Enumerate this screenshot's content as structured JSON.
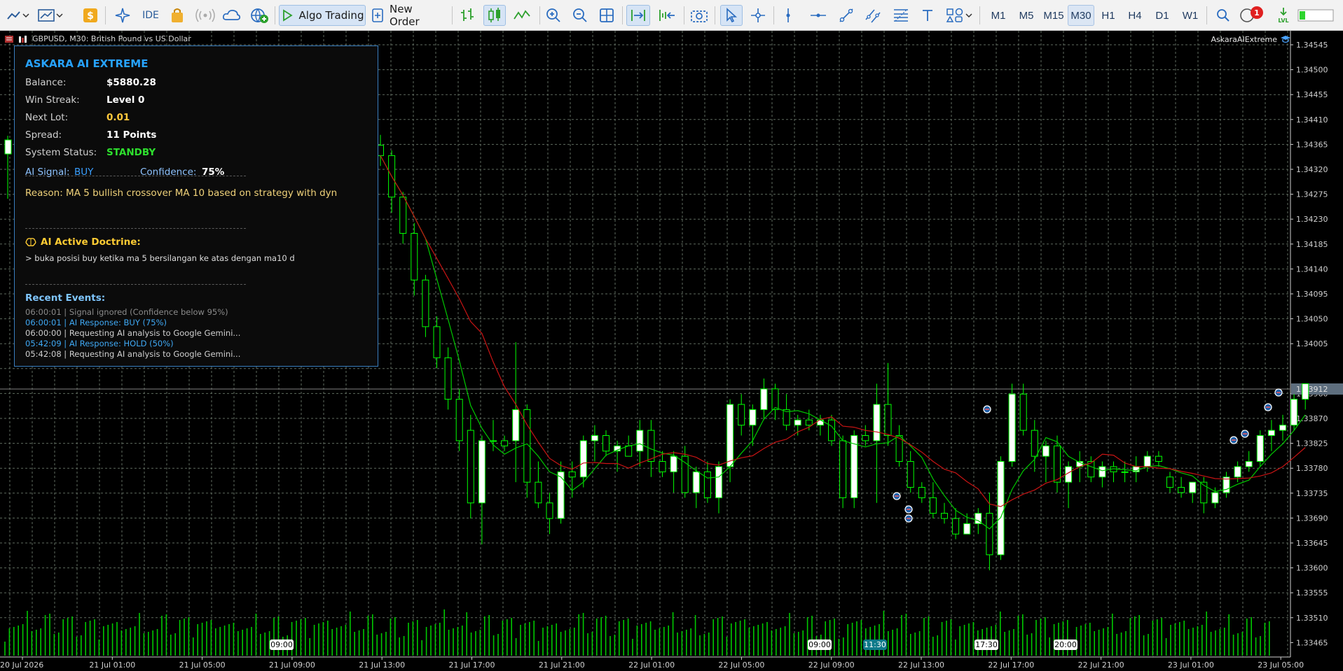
{
  "toolbar": {
    "algo_trading_label": "Algo Trading",
    "new_order_label": "New Order",
    "ide_label": "IDE",
    "notifications_count": "1",
    "timeframes": [
      "M1",
      "M5",
      "M15",
      "M30",
      "H1",
      "H4",
      "D1",
      "W1"
    ],
    "active_timeframe": "M30"
  },
  "chart": {
    "title": "GBPUSD, M30:  British Pound vs US Dollar",
    "ea_name": "AskaraAIExtreme",
    "current_price_label": "1.33912",
    "price_axis_labels": [
      "1.34545",
      "1.34500",
      "1.34455",
      "1.34410",
      "1.34365",
      "1.34320",
      "1.34275",
      "1.34230",
      "1.34185",
      "1.34140",
      "1.34095",
      "1.34050",
      "1.34005",
      "1.33960",
      "1.33870",
      "1.33825",
      "1.33780",
      "1.33735",
      "1.33690",
      "1.33645",
      "1.33600",
      "1.33555",
      "1.33510",
      "1.33465"
    ],
    "time_axis_labels": [
      "20 Jul 2026",
      "21 Jul 01:00",
      "21 Jul 05:00",
      "21 Jul 09:00",
      "21 Jul 13:00",
      "21 Jul 17:00",
      "21 Jul 21:00",
      "22 Jul 01:00",
      "22 Jul 05:00",
      "22 Jul 09:00",
      "22 Jul 13:00",
      "22 Jul 17:00",
      "22 Jul 21:00",
      "23 Jul 01:00",
      "23 Jul 05:00"
    ],
    "session_markers": [
      "09:00",
      "09:00",
      "11:30",
      "17:30",
      "20:00"
    ],
    "colors": {
      "background": "#000000",
      "bull_body": "#ffffff",
      "wick": "#00ff00",
      "ma_fast": "#00c800",
      "ma_slow": "#c81414",
      "volume": "#00c800",
      "grid": "#5f6b5f",
      "axis_text": "#d0d0d0"
    }
  },
  "chart_data": {
    "type": "candlestick",
    "symbol": "GBPUSD",
    "timeframe": "M30",
    "ylim": [
      1.3343,
      1.3458
    ],
    "last_price": 1.33912,
    "candles_ohlc": [
      [
        1.3437,
        1.3439,
        1.3433,
        1.3435
      ],
      [
        1.3435,
        1.3436,
        1.3424,
        1.3427
      ],
      [
        1.3427,
        1.3428,
        1.3418,
        1.342
      ],
      [
        1.342,
        1.3422,
        1.3408,
        1.3411
      ],
      [
        1.3411,
        1.3412,
        1.34,
        1.3402
      ],
      [
        1.3402,
        1.3404,
        1.3394,
        1.3396
      ],
      [
        1.3396,
        1.3398,
        1.3386,
        1.3388
      ],
      [
        1.3388,
        1.339,
        1.3378,
        1.338
      ],
      [
        1.3382,
        1.3385,
        1.3365,
        1.3368
      ],
      [
        1.3368,
        1.3381,
        1.336,
        1.338
      ],
      [
        1.338,
        1.3384,
        1.3378,
        1.338
      ],
      [
        1.338,
        1.3381,
        1.3378,
        1.3379
      ],
      [
        1.338,
        1.3399,
        1.3372,
        1.3386
      ],
      [
        1.3386,
        1.3387,
        1.3369,
        1.3372
      ],
      [
        1.3372,
        1.3376,
        1.3367,
        1.3368
      ],
      [
        1.3368,
        1.337,
        1.3362,
        1.3365
      ],
      [
        1.3365,
        1.3376,
        1.3364,
        1.3374
      ],
      [
        1.3374,
        1.3376,
        1.3369,
        1.3373
      ],
      [
        1.3373,
        1.3381,
        1.3371,
        1.338
      ],
      [
        1.338,
        1.3383,
        1.3376,
        1.3381
      ],
      [
        1.3381,
        1.3382,
        1.3377,
        1.3378
      ],
      [
        1.3378,
        1.338,
        1.3374,
        1.3379
      ],
      [
        1.3379,
        1.3381,
        1.3377,
        1.3377
      ],
      [
        1.3378,
        1.3384,
        1.3375,
        1.3382
      ],
      [
        1.3382,
        1.3384,
        1.3373,
        1.3376
      ],
      [
        1.3376,
        1.3378,
        1.3373,
        1.3374
      ],
      [
        1.3374,
        1.3378,
        1.337,
        1.3377
      ],
      [
        1.3377,
        1.3379,
        1.3369,
        1.337
      ],
      [
        1.337,
        1.3375,
        1.3367,
        1.3374
      ],
      [
        1.3374,
        1.3376,
        1.3368,
        1.3369
      ],
      [
        1.3369,
        1.3376,
        1.3366,
        1.3375
      ],
      [
        1.3375,
        1.3388,
        1.3372,
        1.3387
      ],
      [
        1.3387,
        1.3389,
        1.3381,
        1.3383
      ],
      [
        1.3383,
        1.3387,
        1.3379,
        1.3386
      ],
      [
        1.3386,
        1.3392,
        1.3384,
        1.339
      ],
      [
        1.339,
        1.3391,
        1.3384,
        1.3386
      ],
      [
        1.3386,
        1.3389,
        1.3382,
        1.3383
      ],
      [
        1.3383,
        1.3385,
        1.3381,
        1.3384
      ],
      [
        1.3384,
        1.3386,
        1.3382,
        1.3383
      ],
      [
        1.3383,
        1.3385,
        1.3381,
        1.3384
      ],
      [
        1.3384,
        1.3385,
        1.3379,
        1.338
      ],
      [
        1.338,
        1.3381,
        1.3367,
        1.3369
      ],
      [
        1.3369,
        1.3382,
        1.3367,
        1.3381
      ],
      [
        1.3381,
        1.3383,
        1.3379,
        1.338
      ],
      [
        1.338,
        1.3391,
        1.3368,
        1.3387
      ],
      [
        1.3387,
        1.3395,
        1.3379,
        1.3381
      ],
      [
        1.3381,
        1.3383,
        1.3375,
        1.3376
      ],
      [
        1.3376,
        1.3378,
        1.337,
        1.3371
      ],
      [
        1.3371,
        1.3372,
        1.3368,
        1.3369
      ],
      [
        1.3369,
        1.3372,
        1.3365,
        1.3366
      ],
      [
        1.3366,
        1.3368,
        1.3364,
        1.3365
      ],
      [
        1.3365,
        1.3367,
        1.3361,
        1.3362
      ],
      [
        1.3362,
        1.3366,
        1.3362,
        1.3364
      ],
      [
        1.3364,
        1.3367,
        1.3362,
        1.3366
      ],
      [
        1.3366,
        1.337,
        1.3355,
        1.3358
      ],
      [
        1.3358,
        1.3377,
        1.3357,
        1.3376
      ],
      [
        1.3376,
        1.3391,
        1.3375,
        1.3389
      ],
      [
        1.3389,
        1.3391,
        1.3381,
        1.3382
      ],
      [
        1.3382,
        1.3384,
        1.3374,
        1.3377
      ],
      [
        1.3377,
        1.338,
        1.3372,
        1.3379
      ],
      [
        1.3379,
        1.3381,
        1.337,
        1.3372
      ],
      [
        1.3372,
        1.3376,
        1.3367,
        1.3375
      ],
      [
        1.3375,
        1.3378,
        1.3372,
        1.3376
      ],
      [
        1.3376,
        1.3377,
        1.3372,
        1.3373
      ],
      [
        1.3373,
        1.3376,
        1.3371,
        1.3375
      ],
      [
        1.3375,
        1.3376,
        1.3372,
        1.3374
      ],
      [
        1.3374,
        1.3376,
        1.3372,
        1.3374
      ],
      [
        1.3374,
        1.3377,
        1.3372,
        1.3375
      ],
      [
        1.3375,
        1.3378,
        1.3374,
        1.3377
      ],
      [
        1.3377,
        1.3378,
        1.3375,
        1.3376
      ],
      [
        1.3373,
        1.3374,
        1.337,
        1.3371
      ],
      [
        1.3371,
        1.3373,
        1.3369,
        1.337
      ],
      [
        1.337,
        1.3372,
        1.3368,
        1.3372
      ],
      [
        1.3372,
        1.3373,
        1.3366,
        1.3368
      ],
      [
        1.3368,
        1.3371,
        1.3367,
        1.337
      ],
      [
        1.337,
        1.3374,
        1.3369,
        1.3373
      ],
      [
        1.3373,
        1.3376,
        1.3372,
        1.3375
      ],
      [
        1.3375,
        1.3378,
        1.3374,
        1.3376
      ],
      [
        1.3376,
        1.3382,
        1.3375,
        1.3381
      ],
      [
        1.3381,
        1.3384,
        1.3378,
        1.3382
      ],
      [
        1.3382,
        1.3385,
        1.338,
        1.3383
      ],
      [
        1.3383,
        1.3389,
        1.3382,
        1.3388
      ],
      [
        1.3388,
        1.3391,
        1.3386,
        1.3391
      ]
    ],
    "ma_fast_label": "MA 5",
    "ma_slow_label": "MA 10"
  },
  "panel": {
    "title": "ASKARA AI EXTREME",
    "rows": [
      {
        "key": "Balance:",
        "value": "$5880.28",
        "color": "#ffffff"
      },
      {
        "key": "Win Streak:",
        "value": "Level 0",
        "color": "#ffffff"
      },
      {
        "key": "Next Lot:",
        "value": "0.01",
        "color": "#ffc93c"
      },
      {
        "key": "Spread:",
        "value": "11 Points",
        "color": "#ffffff"
      },
      {
        "key": "System Status:",
        "value": "STANDBY",
        "color": "#2ee02e"
      }
    ],
    "signal_label": "AI Signal:",
    "signal_value": "BUY",
    "confidence_label": "Confidence:",
    "confidence_value": "75%",
    "reason": "Reason: MA 5 bullish crossover MA 10 based on strategy with dyn",
    "doctrine_title": "AI Active Doctrine:",
    "doctrine_text": "> buka posisi buy ketika ma 5 bersilangan ke atas dengan ma10 d",
    "events_title": "Recent Events:",
    "events": [
      {
        "text": "06:00:01 | Signal ignored (Confidence below 95%)",
        "color": "#8a8a8a"
      },
      {
        "text": "06:00:01 | AI Response: BUY (75%)",
        "color": "#3fa9f5"
      },
      {
        "text": "06:00:00 | Requesting AI analysis to Google Gemini...",
        "color": "#cfcfcf"
      },
      {
        "text": "05:42:09 | AI Response: HOLD (50%)",
        "color": "#3fa9f5"
      },
      {
        "text": "05:42:08 | Requesting AI analysis to Google Gemini...",
        "color": "#cfcfcf"
      }
    ]
  }
}
